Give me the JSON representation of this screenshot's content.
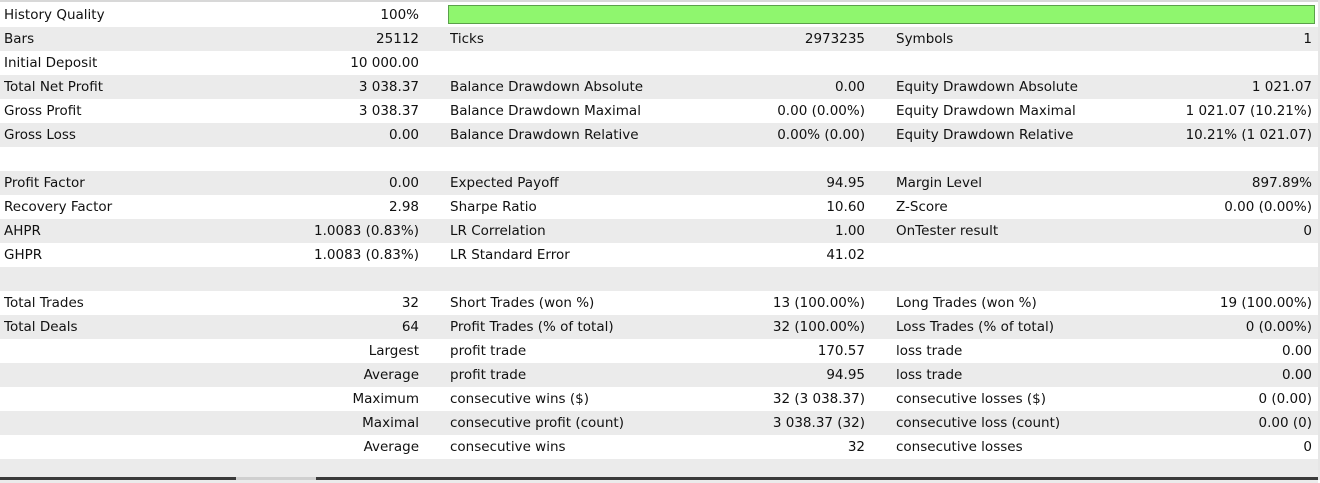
{
  "quality": {
    "label": "History Quality",
    "value": "100%",
    "fraction": 1.0,
    "bar_color": "#8ff66e"
  },
  "rows": [
    {
      "shade": true,
      "c1": "",
      "v1": "",
      "c2": "Ticks",
      "v2": "2973235",
      "c3": "Symbols",
      "v3": "1",
      "left": "Bars",
      "leftv": "25112"
    },
    {
      "shade": false,
      "left": "Initial Deposit",
      "leftv": "10 000.00",
      "c2": "",
      "v2": "",
      "c3": "",
      "v3": ""
    },
    {
      "shade": true,
      "left": "Total Net Profit",
      "leftv": "3 038.37",
      "c2": "Balance Drawdown Absolute",
      "v2": "0.00",
      "c3": "Equity Drawdown Absolute",
      "v3": "1 021.07"
    },
    {
      "shade": false,
      "left": "Gross Profit",
      "leftv": "3 038.37",
      "c2": "Balance Drawdown Maximal",
      "v2": "0.00 (0.00%)",
      "c3": "Equity Drawdown Maximal",
      "v3": "1 021.07 (10.21%)"
    },
    {
      "shade": true,
      "left": "Gross Loss",
      "leftv": "0.00",
      "c2": "Balance Drawdown Relative",
      "v2": "0.00% (0.00)",
      "c3": "Equity Drawdown Relative",
      "v3": "10.21% (1 021.07)"
    },
    {
      "shade": false,
      "left": "",
      "leftv": "",
      "c2": "",
      "v2": "",
      "c3": "",
      "v3": ""
    },
    {
      "shade": true,
      "left": "Profit Factor",
      "leftv": "0.00",
      "c2": "Expected Payoff",
      "v2": "94.95",
      "c3": "Margin Level",
      "v3": "897.89%"
    },
    {
      "shade": false,
      "left": "Recovery Factor",
      "leftv": "2.98",
      "c2": "Sharpe Ratio",
      "v2": "10.60",
      "c3": "Z-Score",
      "v3": "0.00 (0.00%)"
    },
    {
      "shade": true,
      "left": "AHPR",
      "leftv": "1.0083 (0.83%)",
      "c2": "LR Correlation",
      "v2": "1.00",
      "c3": "OnTester result",
      "v3": "0"
    },
    {
      "shade": false,
      "left": "GHPR",
      "leftv": "1.0083 (0.83%)",
      "c2": "LR Standard Error",
      "v2": "41.02",
      "c3": "",
      "v3": ""
    },
    {
      "shade": true,
      "left": "",
      "leftv": "",
      "c2": "",
      "v2": "",
      "c3": "",
      "v3": ""
    },
    {
      "shade": false,
      "left": "Total Trades",
      "leftv": "32",
      "c2": "Short Trades (won %)",
      "v2": "13 (100.00%)",
      "c3": "Long Trades (won %)",
      "v3": "19 (100.00%)"
    },
    {
      "shade": true,
      "left": "Total Deals",
      "leftv": "64",
      "c2": "Profit Trades (% of total)",
      "v2": "32 (100.00%)",
      "c3": "Loss Trades (% of total)",
      "v3": "0 (0.00%)"
    },
    {
      "shade": false,
      "left": "",
      "leftv": "Largest",
      "c2": "profit trade",
      "v2": "170.57",
      "c3": "loss trade",
      "v3": "0.00"
    },
    {
      "shade": true,
      "left": "",
      "leftv": "Average",
      "c2": "profit trade",
      "v2": "94.95",
      "c3": "loss trade",
      "v3": "0.00"
    },
    {
      "shade": false,
      "left": "",
      "leftv": "Maximum",
      "c2": "consecutive wins ($)",
      "v2": "32 (3 038.37)",
      "c3": "consecutive losses ($)",
      "v3": "0 (0.00)"
    },
    {
      "shade": true,
      "left": "",
      "leftv": "Maximal",
      "c2": "consecutive profit (count)",
      "v2": "3 038.37 (32)",
      "c3": "consecutive loss (count)",
      "v3": "0.00 (0)"
    },
    {
      "shade": false,
      "left": "",
      "leftv": "Average",
      "c2": "consecutive wins",
      "v2": "32",
      "c3": "consecutive losses",
      "v3": "0"
    },
    {
      "shade": true,
      "left": "",
      "leftv": "",
      "c2": "",
      "v2": "",
      "c3": "",
      "v3": ""
    }
  ]
}
